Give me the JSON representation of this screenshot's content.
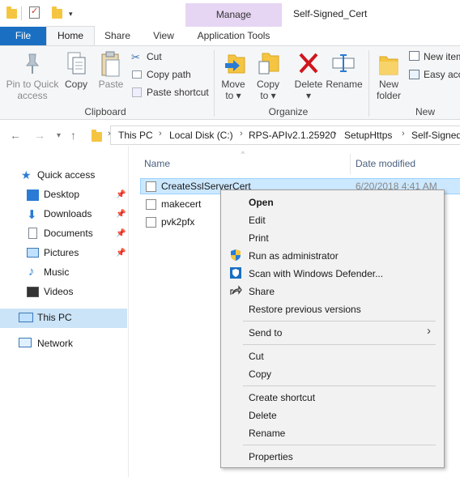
{
  "window": {
    "title": "Self-Signed_Cert",
    "context_tab_group": "Manage"
  },
  "ribbon_tabs": {
    "file": "File",
    "home": "Home",
    "share": "Share",
    "view": "View",
    "app_tools": "Application Tools"
  },
  "ribbon": {
    "clipboard": {
      "group_label": "Clipboard",
      "pin_label_1": "Pin to Quick",
      "pin_label_2": "access",
      "copy": "Copy",
      "paste": "Paste",
      "cut": "Cut",
      "copy_path": "Copy path",
      "paste_shortcut": "Paste shortcut"
    },
    "organize": {
      "group_label": "Organize",
      "move_to_1": "Move",
      "move_to_2": "to",
      "copy_to_1": "Copy",
      "copy_to_2": "to",
      "delete": "Delete",
      "rename": "Rename"
    },
    "new": {
      "group_label": "New",
      "new_folder_1": "New",
      "new_folder_2": "folder",
      "new_item": "New item",
      "easy_access": "Easy acce"
    }
  },
  "address": {
    "crumbs": [
      "This PC",
      "Local Disk (C:)",
      "RPS-APIv2.1.25920",
      "SetupHttps",
      "Self-Signed"
    ]
  },
  "nav": {
    "quick_access": "Quick access",
    "desktop": "Desktop",
    "downloads": "Downloads",
    "documents": "Documents",
    "pictures": "Pictures",
    "music": "Music",
    "videos": "Videos",
    "this_pc": "This PC",
    "network": "Network"
  },
  "columns": {
    "name": "Name",
    "date_modified": "Date modified"
  },
  "files": [
    {
      "name": "CreateSslServerCert",
      "date": "6/20/2018 4:41 AM"
    },
    {
      "name": "makecert"
    },
    {
      "name": "pvk2pfx"
    }
  ],
  "context_menu": {
    "open": "Open",
    "edit": "Edit",
    "print": "Print",
    "run_as_admin": "Run as administrator",
    "scan_defender": "Scan with Windows Defender...",
    "share": "Share",
    "restore_versions": "Restore previous versions",
    "send_to": "Send to",
    "cut": "Cut",
    "copy": "Copy",
    "create_shortcut": "Create shortcut",
    "delete": "Delete",
    "rename": "Rename",
    "properties": "Properties"
  },
  "colors": {
    "file_tab": "#1a6fc2",
    "manage_tab": "#e6d5f3",
    "selection": "#cce8ff",
    "nav_selection": "#cce4f7",
    "folder": "#f5c542",
    "delete_red": "#d0161d"
  }
}
